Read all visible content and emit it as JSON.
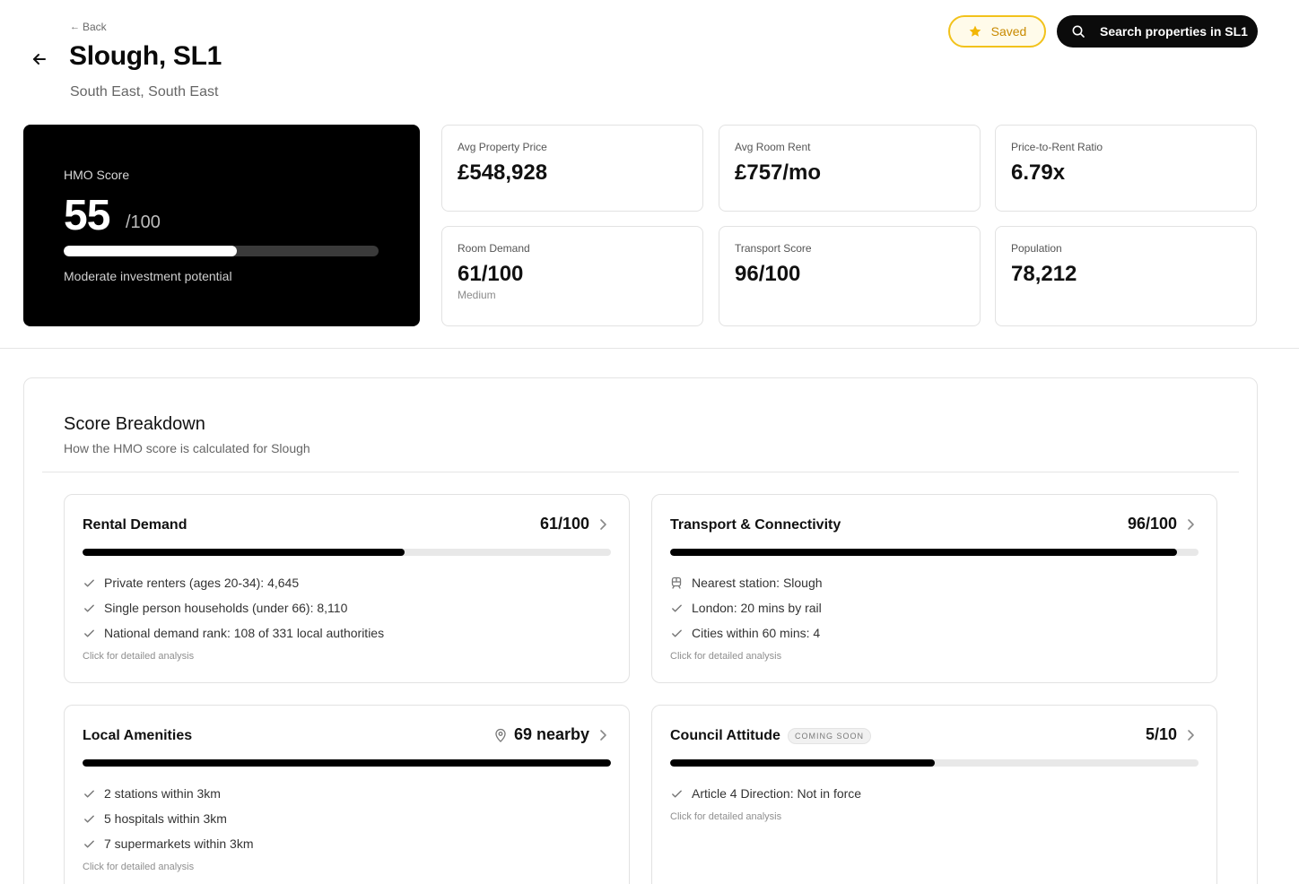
{
  "header": {
    "back_label": "Back",
    "title": "Slough, SL1",
    "subtitle": "South East, South East",
    "saved_label": "Saved",
    "search_label": "Search properties in SL1"
  },
  "hmo": {
    "label": "HMO Score",
    "score": "55",
    "out_of": "/100",
    "progress_percent": 55,
    "description": "Moderate investment potential"
  },
  "stats": {
    "avg_price": {
      "label": "Avg Property Price",
      "value": "£548,928"
    },
    "avg_rent": {
      "label": "Avg Room Rent",
      "value": "£757/mo"
    },
    "ratio": {
      "label": "Price-to-Rent Ratio",
      "value": "6.79x"
    },
    "room_demand": {
      "label": "Room Demand",
      "value": "61/100",
      "sub": "Medium"
    },
    "transport": {
      "label": "Transport Score",
      "value": "96/100"
    },
    "population": {
      "label": "Population",
      "value": "78,212"
    }
  },
  "breakdown": {
    "title": "Score Breakdown",
    "subtitle": "How the HMO score is calculated for Slough",
    "hint": "Click for detailed analysis",
    "rental": {
      "name": "Rental Demand",
      "score": "61/100",
      "progress_percent": 61,
      "items": [
        "Private renters (ages 20-34): 4,645",
        "Single person households (under 66): 8,110",
        "National demand rank: 108 of 331 local authorities"
      ]
    },
    "transport": {
      "name": "Transport & Connectivity",
      "score": "96/100",
      "progress_percent": 96,
      "items": [
        "Nearest station: Slough",
        "London: 20 mins by rail",
        "Cities within 60 mins: 4"
      ]
    },
    "amenities": {
      "name": "Local Amenities",
      "score": "69 nearby",
      "progress_percent": 100,
      "items": [
        "2 stations within 3km",
        "5 hospitals within 3km",
        "7 supermarkets within 3km"
      ]
    },
    "council": {
      "name": "Council Attitude",
      "badge": "COMING SOON",
      "score": "5/10",
      "progress_percent": 50,
      "items": [
        "Article 4 Direction: Not in force"
      ]
    }
  },
  "colors": {
    "accent_yellow": "#f2c21b",
    "black": "#000000"
  }
}
